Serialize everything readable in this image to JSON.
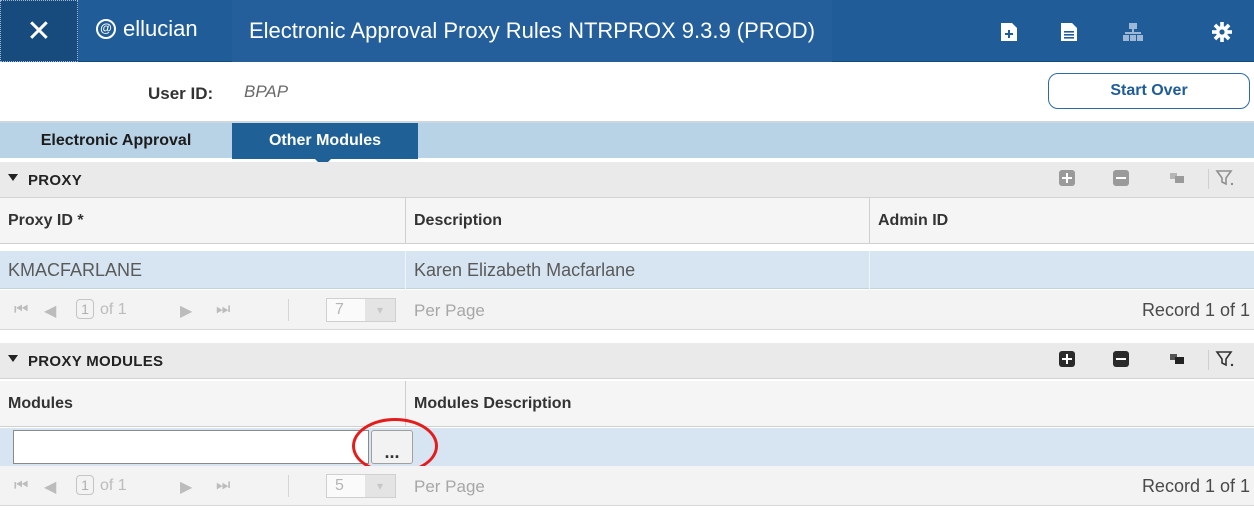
{
  "header": {
    "close_glyph": "✕",
    "logo_text": "ellucian",
    "logo_mark": "@",
    "title": "Electronic Approval Proxy Rules NTRPROX 9.3.9 (PROD)",
    "icons": [
      "add-document-icon",
      "document-icon",
      "hierarchy-icon",
      "gear-icon"
    ]
  },
  "key_block": {
    "user_id_label": "User ID:",
    "user_id_value": "BPAP",
    "start_over_label": "Start Over"
  },
  "tabs": [
    {
      "label": "Electronic Approval",
      "active": false
    },
    {
      "label": "Other Modules",
      "active": true
    }
  ],
  "proxy": {
    "section_title": "PROXY",
    "columns": [
      "Proxy ID *",
      "Description",
      "Admin ID"
    ],
    "rows": [
      {
        "proxy_id": "KMACFARLANE",
        "description": "Karen Elizabeth Macfarlane",
        "admin_id": ""
      }
    ],
    "pager": {
      "page": "1",
      "of_pages": "of 1",
      "per_page_value": "7",
      "per_page_label": "Per Page",
      "record_text": "Record 1 of 1"
    }
  },
  "proxy_modules": {
    "section_title": "PROXY MODULES",
    "columns": [
      "Modules",
      "Modules Description"
    ],
    "input_value": "",
    "lookup_label": "...",
    "pager": {
      "page": "1",
      "of_pages": "of 1",
      "per_page_value": "5",
      "per_page_label": "Per Page",
      "record_text": "Record 1 of 1"
    }
  },
  "colors": {
    "header_bg": "#1f5c98",
    "active_tab": "#1f6196",
    "row_highlight": "#d6e5f1",
    "callout": "#e31c1c"
  }
}
